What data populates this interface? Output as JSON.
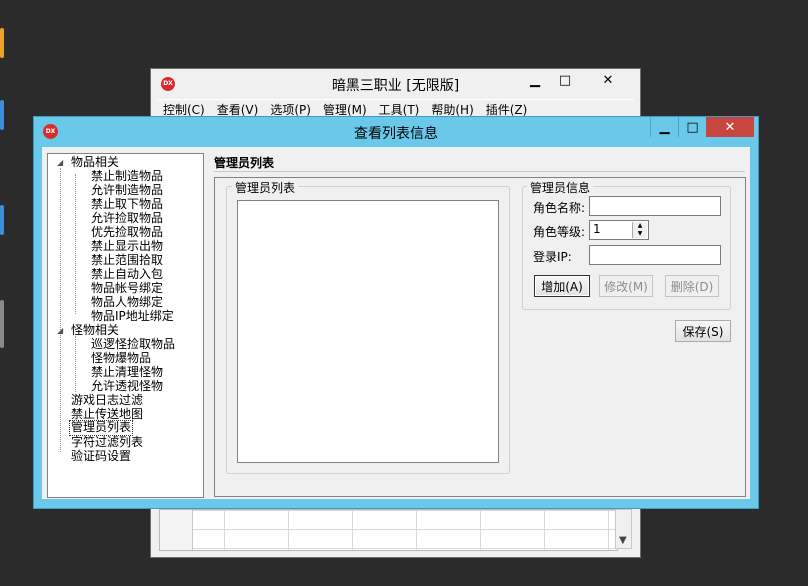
{
  "back_window": {
    "title": "暗黑三职业 [无限版]",
    "logo_text": "DX",
    "buttons": {
      "minimize": "▁",
      "maximize": "□",
      "close": "✕"
    },
    "menu": [
      "控制(C)",
      "查看(V)",
      "选项(P)",
      "管理(M)",
      "工具(T)",
      "帮助(H)",
      "插件(Z)"
    ]
  },
  "dialog": {
    "title": "查看列表信息",
    "logo_text": "DX",
    "buttons": {
      "minimize": "▁",
      "maximize": "□",
      "close": "✕"
    }
  },
  "tree": {
    "groups": [
      {
        "label": "物品相关",
        "children": [
          "禁止制造物品",
          "允许制造物品",
          "禁止取下物品",
          "允许捡取物品",
          "优先捡取物品",
          "禁止显示出物",
          "禁止范围拾取",
          "禁止自动入包",
          "物品帐号绑定",
          "物品人物绑定",
          "物品IP地址绑定"
        ]
      },
      {
        "label": "怪物相关",
        "children": [
          "巡逻怪捡取物品",
          "怪物爆物品",
          "禁止清理怪物",
          "允许透视怪物"
        ]
      }
    ],
    "top_items": [
      "游戏日志过滤",
      "禁止传送地图",
      "管理员列表",
      "字符过滤列表",
      "验证码设置"
    ],
    "selected": "管理员列表"
  },
  "panel": {
    "title": "管理员列表",
    "list_group_label": "管理员列表",
    "info_group_label": "管理员信息",
    "role_name_label": "角色名称:",
    "role_name_value": "",
    "role_level_label": "角色等级:",
    "role_level_value": "1",
    "login_ip_label": "登录IP:",
    "login_ip_value": "",
    "add_button": "增加(A)",
    "edit_button": "修改(M)",
    "delete_button": "删除(D)",
    "save_button": "保存(S)"
  }
}
